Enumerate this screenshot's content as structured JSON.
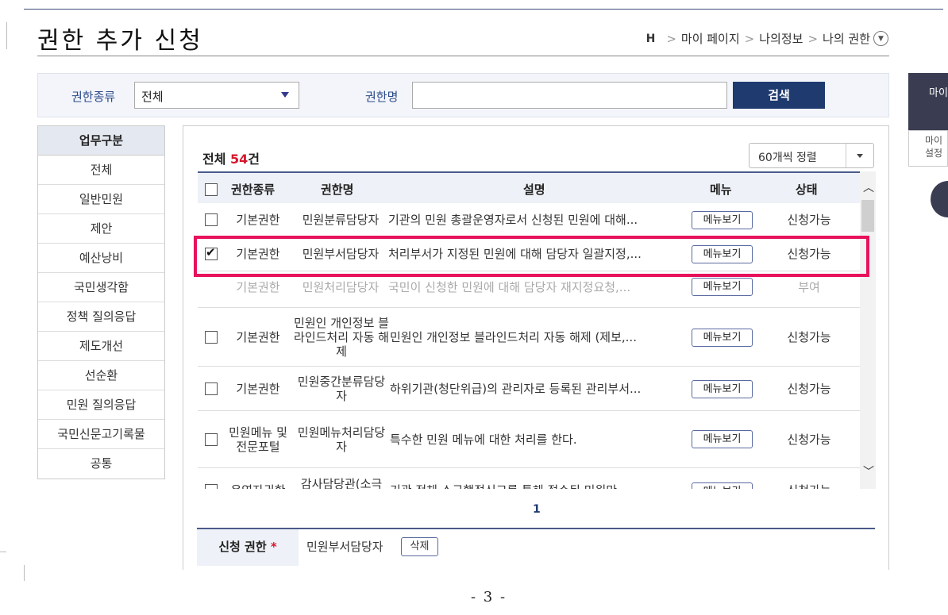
{
  "header": {
    "title": "권한 추가 신청",
    "breadcrumb": {
      "home": "H",
      "items": [
        "마이 페이지",
        "나의정보",
        "나의 권한"
      ]
    }
  },
  "search": {
    "type_label": "권한종류",
    "type_value": "전체",
    "name_label": "권한명",
    "name_value": "",
    "button": "검색"
  },
  "categories": {
    "header": "업무구분",
    "items": [
      "전체",
      "일반민원",
      "제안",
      "예산낭비",
      "국민생각함",
      "정책 질의응답",
      "제도개선",
      "선순환",
      "민원 질의응답",
      "국민신문고기록물",
      "공통"
    ]
  },
  "list": {
    "total_prefix": "전체 ",
    "total_count": "54",
    "total_suffix": "건",
    "sort_label": "60개씩 정렬",
    "columns": [
      "권한종류",
      "권한명",
      "설명",
      "메뉴",
      "상태"
    ],
    "rows": [
      {
        "type": "기본권한",
        "name": "민원분류담당자",
        "desc": "기관의 민원 총괄운영자로서 신청된 민원에 대해...",
        "menu": "메뉴보기",
        "status": "신청가능",
        "checked": false
      },
      {
        "type": "기본권한",
        "name": "민원부서담당자",
        "desc": "처리부서가 지정된 민원에 대해 담당자 일괄지정,...",
        "menu": "메뉴보기",
        "status": "신청가능",
        "checked": true
      },
      {
        "type": "기본권한",
        "name": "민원처리담당자",
        "desc": "국민이 신청한 민원에 대해 담당자 재지정요청,...",
        "menu": "메뉴보기",
        "status": "부여",
        "checked": false
      },
      {
        "type": "기본권한",
        "name": "민원인 개인정보 블라인드처리 자동 해제",
        "desc": "민원인 개인정보 블라인드처리 자동 해제 (제보,...",
        "menu": "메뉴보기",
        "status": "신청가능",
        "checked": false
      },
      {
        "type": "기본권한",
        "name": "민원중간분류담당자",
        "desc": "하위기관(청단위급)의 관리자로 등록된 관리부서...",
        "menu": "메뉴보기",
        "status": "신청가능",
        "checked": false
      },
      {
        "type": "민원메뉴 및 전문포털",
        "name": "민원메뉴처리담당자",
        "desc": "특수한 민원 메뉴에 대한 처리를 한다.",
        "menu": "메뉴보기",
        "status": "신청가능",
        "checked": false
      },
      {
        "type": "운영자권한",
        "name": "감사담당관(소극",
        "desc": "기관 전체 소극행정신고를 통해 접수된 민원만",
        "menu": "메뉴보기",
        "status": "신청가능",
        "checked": false
      }
    ]
  },
  "pagination": {
    "current": "1"
  },
  "apply": {
    "label": "신청 권한",
    "required": "*",
    "value": "민원부서담당자",
    "delete": "삭제"
  },
  "side": {
    "top": "마이",
    "sub1": "마이",
    "sub2": "설정"
  },
  "footer": {
    "page": "- 3 -"
  }
}
